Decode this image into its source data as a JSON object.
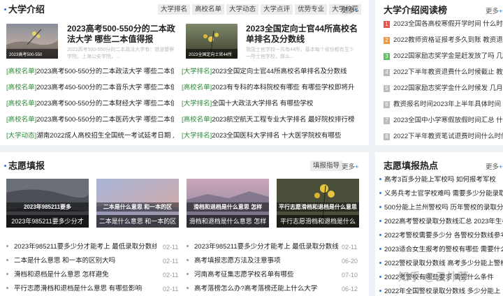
{
  "intro": {
    "title": "大学介绍",
    "tags": [
      "大学排名",
      "高校名单",
      "大学动态",
      "大学点评",
      "优势专业",
      "大学校花"
    ],
    "more": "更多",
    "more_plus": "+",
    "features": [
      {
        "title": "2023高考500-550分的二本政法大学 哪些二本值得报",
        "desc": "2023高考500-550分的二本政法大学有：铁道警察学院，上海公安学院，...",
        "thumb_caption": "2023高考500-550"
      },
      {
        "title": "2023全国定向士官44所高校名单排名及分数线",
        "desc": "我国士官学校一共有44所，基本每个省份都有至少一所士官学校，那么...",
        "thumb_caption": "2023全国定向士官44所"
      }
    ],
    "left_links": [
      {
        "cat": "[高校名单]",
        "text": "2023高考500-550分的二本政法大学 哪些二本值得"
      },
      {
        "cat": "[高校名单]",
        "text": "2023高考450-500分的二本音乐大学 哪些二本值得"
      },
      {
        "cat": "[高校名单]",
        "text": "2023高考500-550分的二本财经大学 哪些二本值得"
      },
      {
        "cat": "[高校名单]",
        "text": "2023高考500-550分的二本医药大学 哪些二本值得"
      },
      {
        "cat": "[大学动态]",
        "text": "湖南2022成人高校招生全国统一考试延考日期 几"
      }
    ],
    "right_links": [
      {
        "cat": "[大学排名]",
        "text": "2023全国定向士官44所高校名单排名及分数线"
      },
      {
        "cat": "[高校名单]",
        "text": "2023有专科的本科院校有哪些 有哪些学校即将升"
      },
      {
        "cat": "[大学排名]",
        "text": "全国十大政法大学排名 有哪些学校"
      },
      {
        "cat": "[高校名单]",
        "text": "2023航空航天工程专业大学排名 最好院校排行榜"
      },
      {
        "cat": "[大学排名]",
        "text": "2023全国医科大学排名 十大医学院校有哪些"
      }
    ]
  },
  "ranking": {
    "title": "大学介绍阅读榜",
    "more": "更多",
    "more_plus": "+",
    "items": [
      {
        "num": "1",
        "color": "#e8554e",
        "text": "2023全国各高校寒假开学时间 什么时候"
      },
      {
        "num": "2",
        "color": "#f29a3a",
        "text": "2022教师资格证报考多久到账 教资退费时"
      },
      {
        "num": "3",
        "color": "#5fbf5f",
        "text": "2022国家励志奖学金是赶发放了吗 几号到"
      },
      {
        "num": "4",
        "color": "#bbbbbb",
        "text": "2022下半年教资退费什么时候截止 教师资"
      },
      {
        "num": "5",
        "color": "#bbbbbb",
        "text": "2022国家励志奖学金什么时候发 几月几日"
      },
      {
        "num": "6",
        "color": "#bbbbbb",
        "text": "教资报名时间2023年上半年具体时间"
      },
      {
        "num": "7",
        "color": "#bbbbbb",
        "text": "2023全国中小学寒假放假时间汇总 什么时"
      },
      {
        "num": "8",
        "color": "#bbbbbb",
        "text": "2022下半年教资笔试退费时间什么时候"
      }
    ]
  },
  "zhiyuan": {
    "title": "志愿填报",
    "tag": "填报指导",
    "more": "更多",
    "more_plus": "+",
    "cards": [
      {
        "band": "2023年985211要多",
        "caption": "2023年985211要多少分才"
      },
      {
        "band": "二本是什么意思 和一本的区",
        "caption": "二本是什么意思 和一本的区"
      },
      {
        "band": "滑档和退档是什么意思 怎样",
        "caption": "滑档和退档是什么意思 怎样"
      },
      {
        "band": "平行志愿滑档和退档是什么意思",
        "caption": "平行志愿滑档和退档是什么"
      }
    ],
    "left_list": [
      {
        "text": "2023年985211要多少分才能考上 最低录取分数线",
        "date": "02-11"
      },
      {
        "text": "二本是什么意思 和一本的区别大吗",
        "date": "02-11"
      },
      {
        "text": "滑档和退档是什么意思 怎样避免",
        "date": "02-11"
      },
      {
        "text": "平行志愿滑档和退档是什么意思 有哪些影响",
        "date": "02-11"
      }
    ],
    "right_list": [
      {
        "text": "2023年985211要多少分才能考上 最低录取分数线",
        "date": "02-11"
      },
      {
        "text": "高考填报志愿方法及注意事项",
        "date": "06-20"
      },
      {
        "text": "河南高考征集志愿学校名单有哪些",
        "date": "07-10"
      },
      {
        "text": "高考落榜怎么办?高考落榜还能上什么大学",
        "date": "06-12"
      }
    ]
  },
  "hot": {
    "title": "志愿填报热点",
    "more": "更多",
    "more_plus": "+",
    "items": [
      "高考3百多分能上军校吗 如何报考军校",
      "义务兵考士官学校难吗 需要多少分能录取",
      "500分能上兰州警校吗 历年警校的录取分数",
      "2022高考警校录取分数线汇总 2023年生参",
      "2022考警校需要多少分 各警校分数线参考",
      "2023适合女生报考的警校有哪些 需要什么",
      "2022警校录取分数线 高考多少分能上警校",
      "2022考警校有哪些要求 需要什么条件",
      "2022年全国警校录取分数线 多少分能上",
      "2023报考"
    ]
  },
  "watermark": "知乎 @云外荐"
}
